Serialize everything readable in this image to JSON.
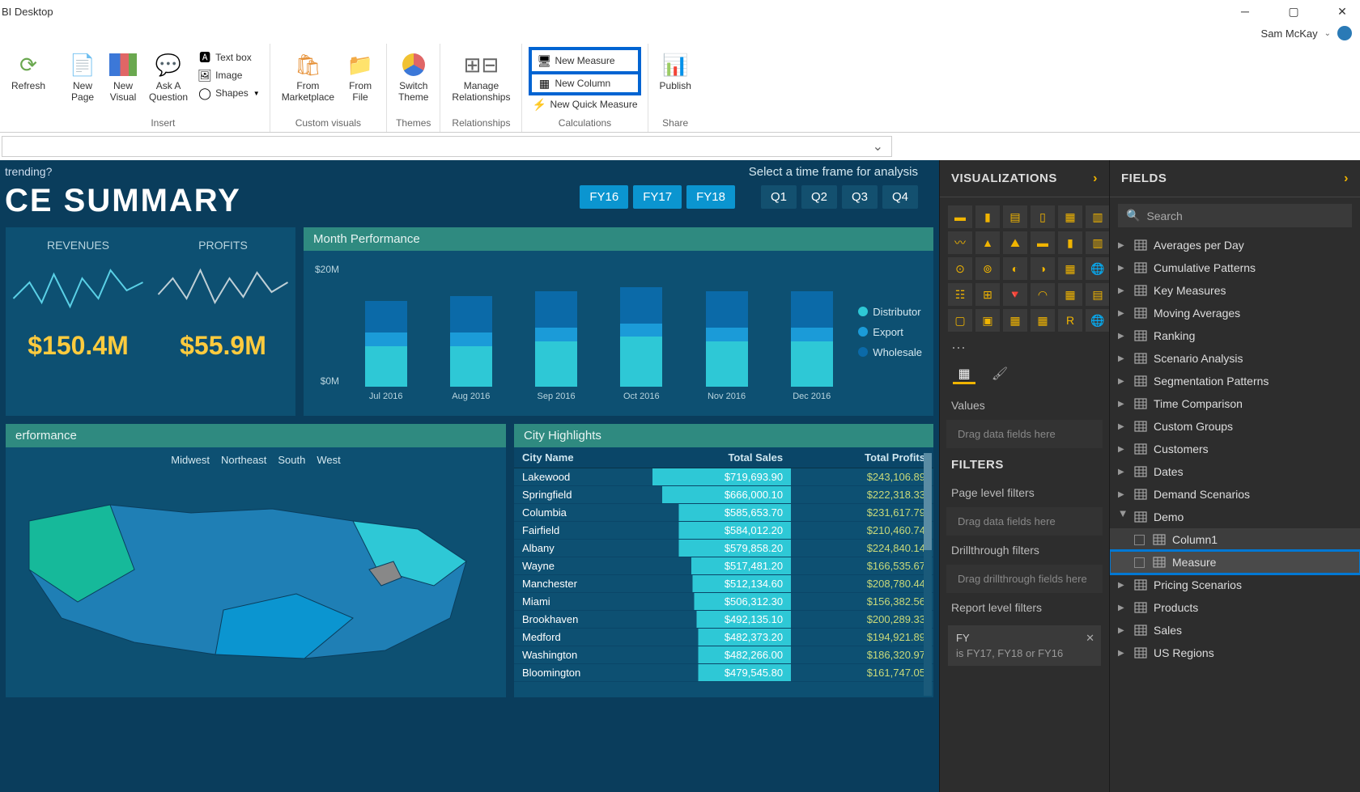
{
  "window": {
    "title": "BI Desktop"
  },
  "user": {
    "name": "Sam McKay"
  },
  "ribbon": {
    "refresh": "Refresh",
    "insert": {
      "label": "Insert",
      "new_page": "New\nPage",
      "new_visual": "New\nVisual",
      "ask": "Ask A\nQuestion",
      "textbox": "Text box",
      "image": "Image",
      "shapes": "Shapes"
    },
    "custom": {
      "label": "Custom visuals",
      "marketplace": "From\nMarketplace",
      "file": "From\nFile"
    },
    "themes": {
      "label": "Themes",
      "switch": "Switch\nTheme"
    },
    "relationships": {
      "label": "Relationships",
      "manage": "Manage\nRelationships"
    },
    "calc": {
      "label": "Calculations",
      "new_measure": "New Measure",
      "new_column": "New Column",
      "new_quick": "New Quick Measure"
    },
    "share": {
      "label": "Share",
      "publish": "Publish"
    }
  },
  "report": {
    "question": "trending?",
    "title": "CE SUMMARY",
    "timeframe": {
      "label": "Select a time frame for analysis",
      "fy": [
        "FY16",
        "FY17",
        "FY18"
      ],
      "q": [
        "Q1",
        "Q2",
        "Q3",
        "Q4"
      ]
    },
    "kpi": {
      "revenues_label": "REVENUES",
      "revenues_value": "$150.4M",
      "profits_label": "PROFITS",
      "profits_value": "$55.9M"
    },
    "month_perf": {
      "title": "Month Performance",
      "y_ticks": [
        "$20M",
        "$0M"
      ],
      "categories": [
        "Jul 2016",
        "Aug 2016",
        "Sep 2016",
        "Oct 2016",
        "Nov 2016",
        "Dec 2016"
      ],
      "legend": [
        "Distributor",
        "Export",
        "Wholesale"
      ]
    },
    "region_perf": {
      "title": "erformance",
      "legend": [
        "Midwest",
        "Northeast",
        "South",
        "West"
      ]
    },
    "city": {
      "title": "City Highlights",
      "cols": [
        "City Name",
        "Total Sales",
        "Total Profits"
      ],
      "rows": [
        [
          "Lakewood",
          "$719,693.90",
          "$243,106.89"
        ],
        [
          "Springfield",
          "$666,000.10",
          "$222,318.33"
        ],
        [
          "Columbia",
          "$585,653.70",
          "$231,617.79"
        ],
        [
          "Fairfield",
          "$584,012.20",
          "$210,460.74"
        ],
        [
          "Albany",
          "$579,858.20",
          "$224,840.14"
        ],
        [
          "Wayne",
          "$517,481.20",
          "$166,535.67"
        ],
        [
          "Manchester",
          "$512,134.60",
          "$208,780.44"
        ],
        [
          "Miami",
          "$506,312.30",
          "$156,382.56"
        ],
        [
          "Brookhaven",
          "$492,135.10",
          "$200,289.33"
        ],
        [
          "Medford",
          "$482,373.20",
          "$194,921.89"
        ],
        [
          "Washington",
          "$482,266.00",
          "$186,320.97"
        ],
        [
          "Bloomington",
          "$479,545.80",
          "$161,747.05"
        ]
      ]
    }
  },
  "chart_data": {
    "type": "bar",
    "stacked": true,
    "title": "Month Performance",
    "xlabel": "",
    "ylabel": "",
    "ylim": [
      0,
      25000000
    ],
    "categories": [
      "Jul 2016",
      "Aug 2016",
      "Sep 2016",
      "Oct 2016",
      "Nov 2016",
      "Dec 2016"
    ],
    "series": [
      {
        "name": "Distributor",
        "color": "#2ec8d6",
        "values": [
          9,
          9,
          10,
          11,
          10,
          10
        ]
      },
      {
        "name": "Export",
        "color": "#1b9bd8",
        "values": [
          3,
          3,
          3,
          3,
          3,
          3
        ]
      },
      {
        "name": "Wholesale",
        "color": "#0b6aa8",
        "values": [
          7,
          8,
          8,
          8,
          8,
          8
        ]
      }
    ],
    "unit": "$M"
  },
  "vis_panel": {
    "title": "VISUALIZATIONS",
    "values": "Values",
    "drag_values": "Drag data fields here",
    "filters_title": "FILTERS",
    "page_filters": "Page level filters",
    "drag_filters": "Drag data fields here",
    "drill": "Drillthrough filters",
    "drag_drill": "Drag drillthrough fields here",
    "report_filters": "Report level filters",
    "chip_name": "FY",
    "chip_desc": "is FY17, FY18 or FY16"
  },
  "fields_panel": {
    "title": "FIELDS",
    "search": "Search",
    "tables": [
      "Averages per Day",
      "Cumulative Patterns",
      "Key Measures",
      "Moving Averages",
      "Ranking",
      "Scenario Analysis",
      "Segmentation Patterns",
      "Time Comparison",
      "Custom Groups",
      "Customers",
      "Dates",
      "Demand Scenarios"
    ],
    "demo": "Demo",
    "demo_cols": [
      "Column1",
      "Measure"
    ],
    "tables2": [
      "Pricing Scenarios",
      "Products",
      "Sales",
      "US Regions"
    ]
  }
}
